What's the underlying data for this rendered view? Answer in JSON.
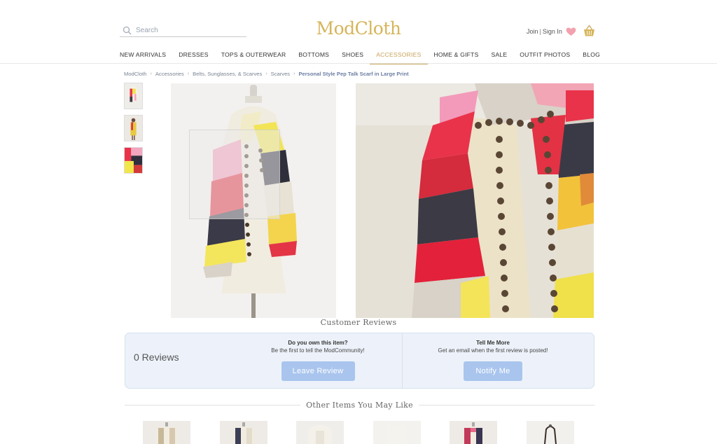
{
  "header": {
    "search_placeholder": "Search",
    "logo": "ModCloth",
    "join": "Join",
    "separator": "|",
    "sign_in": "Sign In",
    "accent_color": "#d6b55a"
  },
  "nav": {
    "items": [
      "NEW ARRIVALS",
      "DRESSES",
      "TOPS & OUTERWEAR",
      "BOTTOMS",
      "SHOES",
      "ACCESSORIES",
      "HOME & GIFTS",
      "SALE",
      "OUTFIT PHOTOS",
      "BLOG"
    ],
    "active": "ACCESSORIES"
  },
  "breadcrumb": {
    "items": [
      "ModCloth",
      "Accessories",
      "Belts, Sunglasses, & Scarves",
      "Scarves"
    ],
    "current": "Personal Style Pep Talk Scarf in Large Print"
  },
  "reviews": {
    "heading": "Customer Reviews",
    "count": "0 Reviews",
    "own_question": "Do you own this item?",
    "own_sub": "Be the first to tell the ModCommunity!",
    "leave_button": "Leave Review",
    "tell_title": "Tell Me More",
    "tell_sub": "Get an email when the first review is posted!",
    "notify_button": "Notify Me",
    "button_color": "#a9c5ee"
  },
  "recommendations": {
    "heading": "Other Items You May Like"
  },
  "icons": [
    "search-icon",
    "heart-icon",
    "basket-icon",
    "chevron-right-icon"
  ]
}
